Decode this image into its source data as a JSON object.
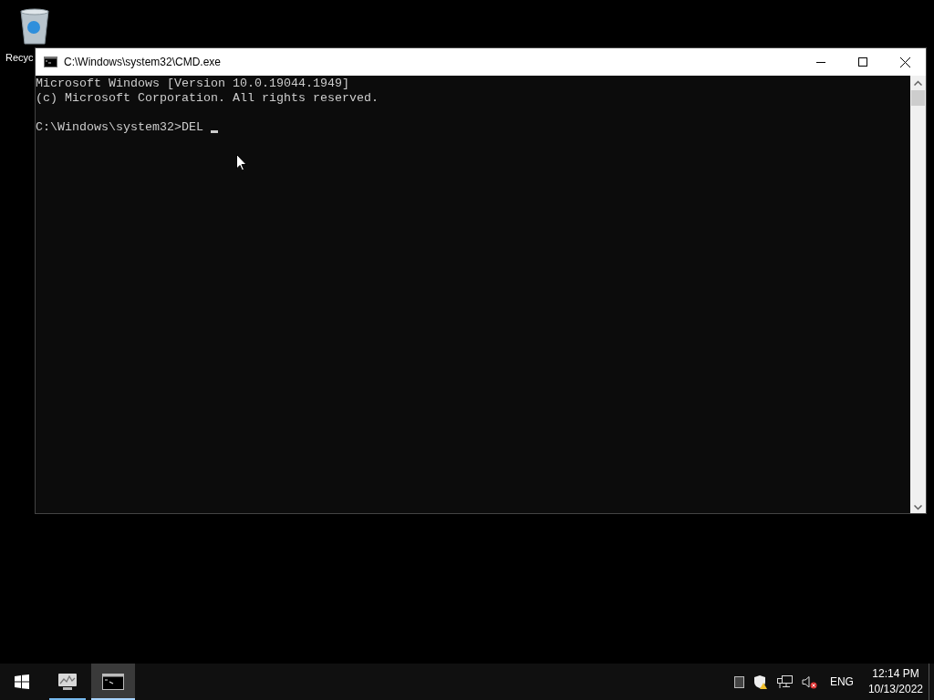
{
  "desktop": {
    "icons": [
      {
        "label": "Recyc"
      }
    ]
  },
  "window": {
    "title": "C:\\Windows\\system32\\CMD.exe",
    "banner": [
      "Microsoft Windows [Version 10.0.19044.1949]",
      "(c) Microsoft Corporation. All rights reserved."
    ],
    "prompt": "C:\\Windows\\system32>DEL "
  },
  "taskbar": {
    "apps": [
      {
        "kind": "monitor",
        "running": true,
        "selected": false
      },
      {
        "kind": "console",
        "running": true,
        "selected": true
      }
    ],
    "tray": {
      "language": "ENG",
      "time": "12:14 PM",
      "date": "10/13/2022"
    }
  }
}
